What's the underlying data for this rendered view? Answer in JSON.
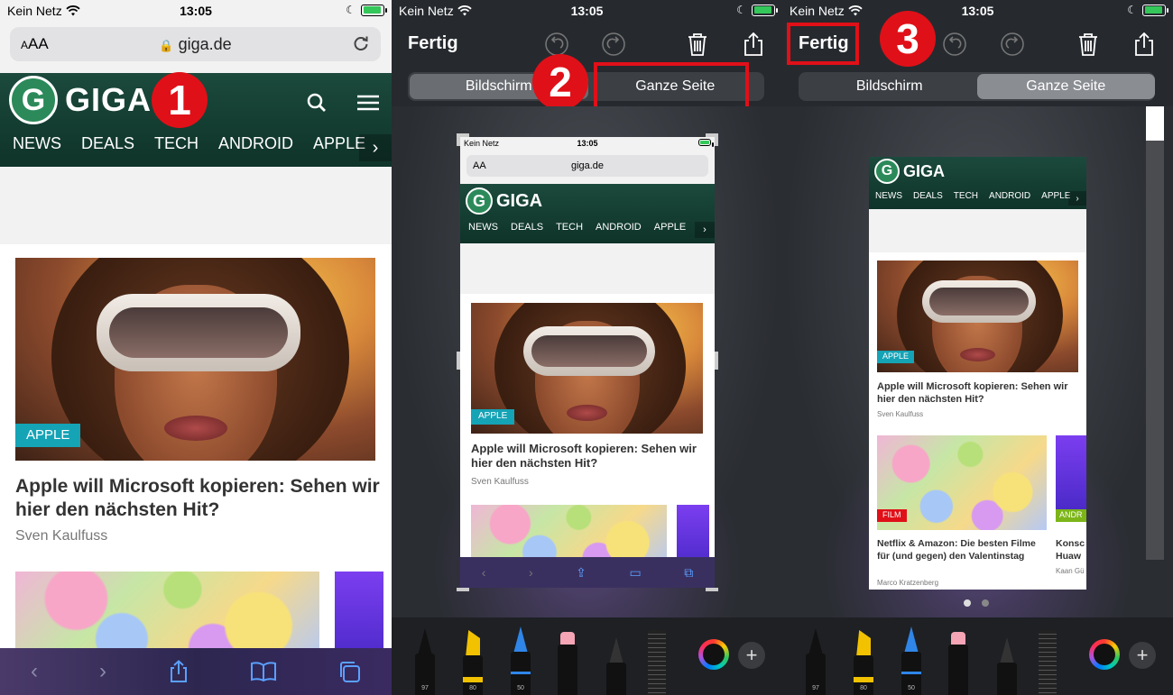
{
  "status": {
    "carrier": "Kein Netz",
    "time": "13:05"
  },
  "safari": {
    "text_size": "AA",
    "url": "giga.de"
  },
  "site": {
    "logo": "GIGA",
    "logo_letter": "G",
    "nav": [
      "NEWS",
      "DEALS",
      "TECH",
      "ANDROID",
      "APPLE"
    ],
    "article1": {
      "tag": "APPLE",
      "title": "Apple will Microsoft kopieren: Sehen wir hier den nächsten Hit?",
      "author": "Sven Kaulfuss"
    },
    "article2": {
      "tag": "FILM",
      "title": "Netflix & Amazon: Die besten Filme für (und gegen) den Valentinstag",
      "author": "Marco Kratzenberg"
    },
    "article3": {
      "tag": "ANDR",
      "title": "Konsc Huaw",
      "author": "Kaan Gü"
    }
  },
  "markup": {
    "done": "Fertig",
    "segment_screen": "Bildschirm",
    "segment_full": "Ganze Seite",
    "pen_numbers": [
      "97",
      "80",
      "50"
    ]
  },
  "steps": [
    "1",
    "2",
    "3"
  ],
  "colors": {
    "giga_green": "#1b4a3c",
    "tag_teal": "#15a3b6",
    "tag_red": "#e01018",
    "tag_green": "#7cb518",
    "callout_red": "#e01018",
    "ios_blue": "#5aa0ff"
  }
}
